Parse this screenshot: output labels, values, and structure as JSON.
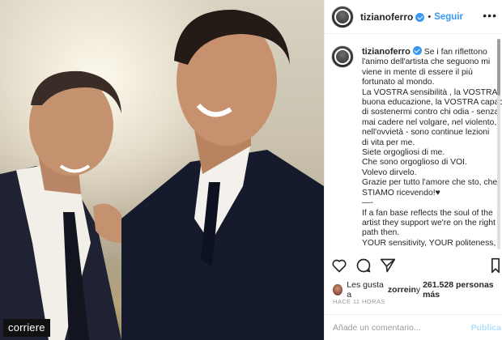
{
  "post": {
    "watermark": "corriere"
  },
  "header": {
    "username": "tizianoferro",
    "separator": "•",
    "follow_label": "Seguir",
    "more_icon": "ellipsis-icon"
  },
  "caption": {
    "username": "tizianoferro",
    "lines": [
      "Se i fan riflettono",
      "l'animo dell'artista che seguono mi",
      "viene in mente di essere il più",
      "fortunato al mondo.",
      "La VOSTRA sensibilità , la VOSTRA",
      "buona educazione, la VOSTRA capacità",
      "di sostenermi contro chi odia - senza",
      "mai cadere nel volgare, nel violento,",
      "nell'ovvietà - sono continue lezioni",
      "di vita per me.",
      "Siete orgogliosi di me.",
      "Che sono orgoglioso di VOI.",
      "Volevo dirvelo.",
      "Grazie per tutto l'amore che sto, che",
      "STIAMO ricevendo!♥",
      "—-",
      "If a fan base reflects the soul of the",
      "artist they support we're on the right",
      "path then.",
      "YOUR sensitivity, YOUR politeness,"
    ]
  },
  "actions": {
    "like_icon": "heart-icon",
    "comment_icon": "comment-icon",
    "share_icon": "share-icon",
    "save_icon": "bookmark-icon"
  },
  "likes": {
    "prefix": "Les gusta a ",
    "user": "zorrein",
    "middle": " y ",
    "count": "261.528 personas más"
  },
  "time": "HACE 11 HORAS",
  "comment_box": {
    "placeholder": "Añade un comentario...",
    "publish_label": "Publica"
  },
  "colors": {
    "accent": "#3897f0",
    "publish_disabled": "#b2dffc",
    "muted": "#999999"
  }
}
